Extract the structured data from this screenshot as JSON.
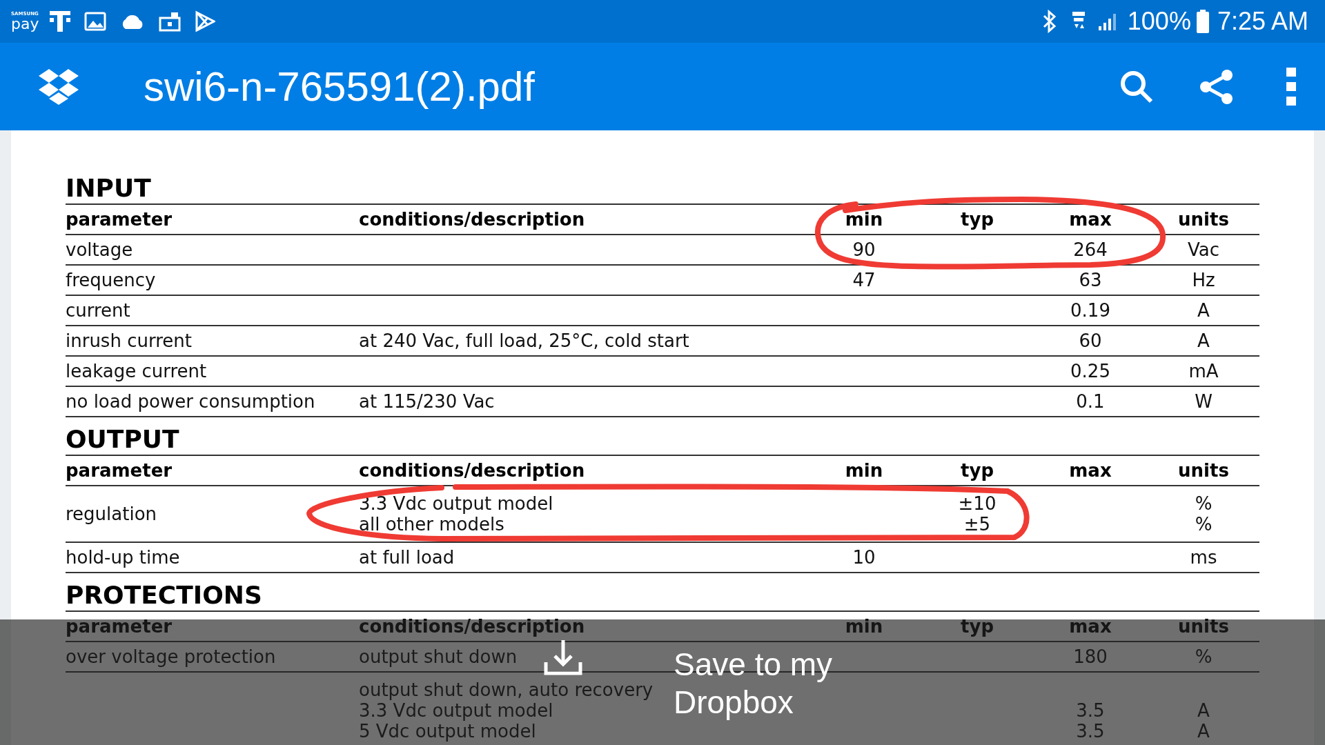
{
  "status_bar": {
    "pay_brand": "SAMSUNG",
    "pay_label": "pay",
    "battery": "100%",
    "time": "7:25 AM"
  },
  "app_bar": {
    "title": "swi6-n-765591(2).pdf"
  },
  "sections": [
    {
      "title": "INPUT",
      "columns": [
        "parameter",
        "conditions/description",
        "min",
        "typ",
        "max",
        "units"
      ],
      "rows": [
        [
          "voltage",
          "",
          "90",
          "",
          "264",
          "Vac"
        ],
        [
          "frequency",
          "",
          "47",
          "",
          "63",
          "Hz"
        ],
        [
          "current",
          "",
          "",
          "",
          "0.19",
          "A"
        ],
        [
          "inrush current",
          "at 240 Vac, full load, 25°C, cold start",
          "",
          "",
          "60",
          "A"
        ],
        [
          "leakage current",
          "",
          "",
          "",
          "0.25",
          "mA"
        ],
        [
          "no load power consumption",
          "at 115/230 Vac",
          "",
          "",
          "0.1",
          "W"
        ]
      ]
    },
    {
      "title": "OUTPUT",
      "columns": [
        "parameter",
        "conditions/description",
        "min",
        "typ",
        "max",
        "units"
      ],
      "rows": [
        [
          "regulation",
          "3.3 Vdc output model\nall other models",
          "",
          "±10\n±5",
          "",
          "%\n%"
        ],
        [
          "hold-up time",
          "at full load",
          "10",
          "",
          "",
          "ms"
        ]
      ]
    },
    {
      "title": "PROTECTIONS",
      "columns": [
        "parameter",
        "conditions/description",
        "min",
        "typ",
        "max",
        "units"
      ],
      "rows": [
        [
          "over voltage protection",
          "output shut down",
          "",
          "",
          "180",
          "%"
        ],
        [
          "",
          "output shut down, auto recovery\n3.3 Vdc output model\n5 Vdc output model",
          "",
          "",
          "\n3.5\n3.5",
          "\nA\nA"
        ]
      ]
    }
  ],
  "save_bar": {
    "label": "Save to my Dropbox"
  }
}
